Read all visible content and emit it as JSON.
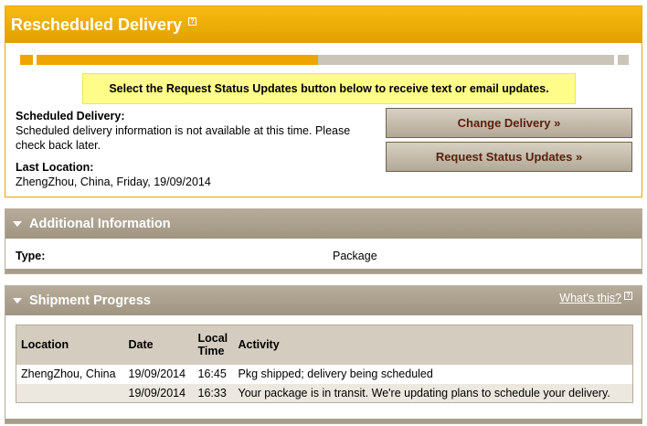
{
  "rescheduled": {
    "title": "Rescheduled Delivery",
    "help_icon": "help-icon",
    "progress_fraction": 0.49,
    "notice": "Select the Request Status Updates button below to receive text or email updates.",
    "scheduled_label": "Scheduled Delivery:",
    "scheduled_text": "Scheduled delivery information is not available at this time. Please check back later.",
    "last_location_label": "Last Location:",
    "last_location_value": "ZhengZhou, China, Friday, 19/09/2014",
    "change_button": "Change Delivery »",
    "status_button": "Request Status Updates »"
  },
  "additional": {
    "title": "Additional Information",
    "type_label": "Type:",
    "type_value": "Package"
  },
  "shipment": {
    "title": "Shipment Progress",
    "whats_this": "What's this?",
    "columns": [
      "Location",
      "Date",
      "Local Time",
      "Activity"
    ],
    "rows": [
      {
        "location": "ZhengZhou, China",
        "date": "19/09/2014",
        "time": "16:45",
        "activity": "Pkg shipped; delivery being scheduled"
      },
      {
        "location": "",
        "date": "19/09/2014",
        "time": "16:33",
        "activity": "Your package is in transit. We're updating plans to schedule your delivery."
      }
    ]
  },
  "colors": {
    "header_orange": "#efa500",
    "section_tan": "#a89d8a",
    "notice_yellow": "#fffd8a",
    "button_text": "#5a1f0c"
  }
}
